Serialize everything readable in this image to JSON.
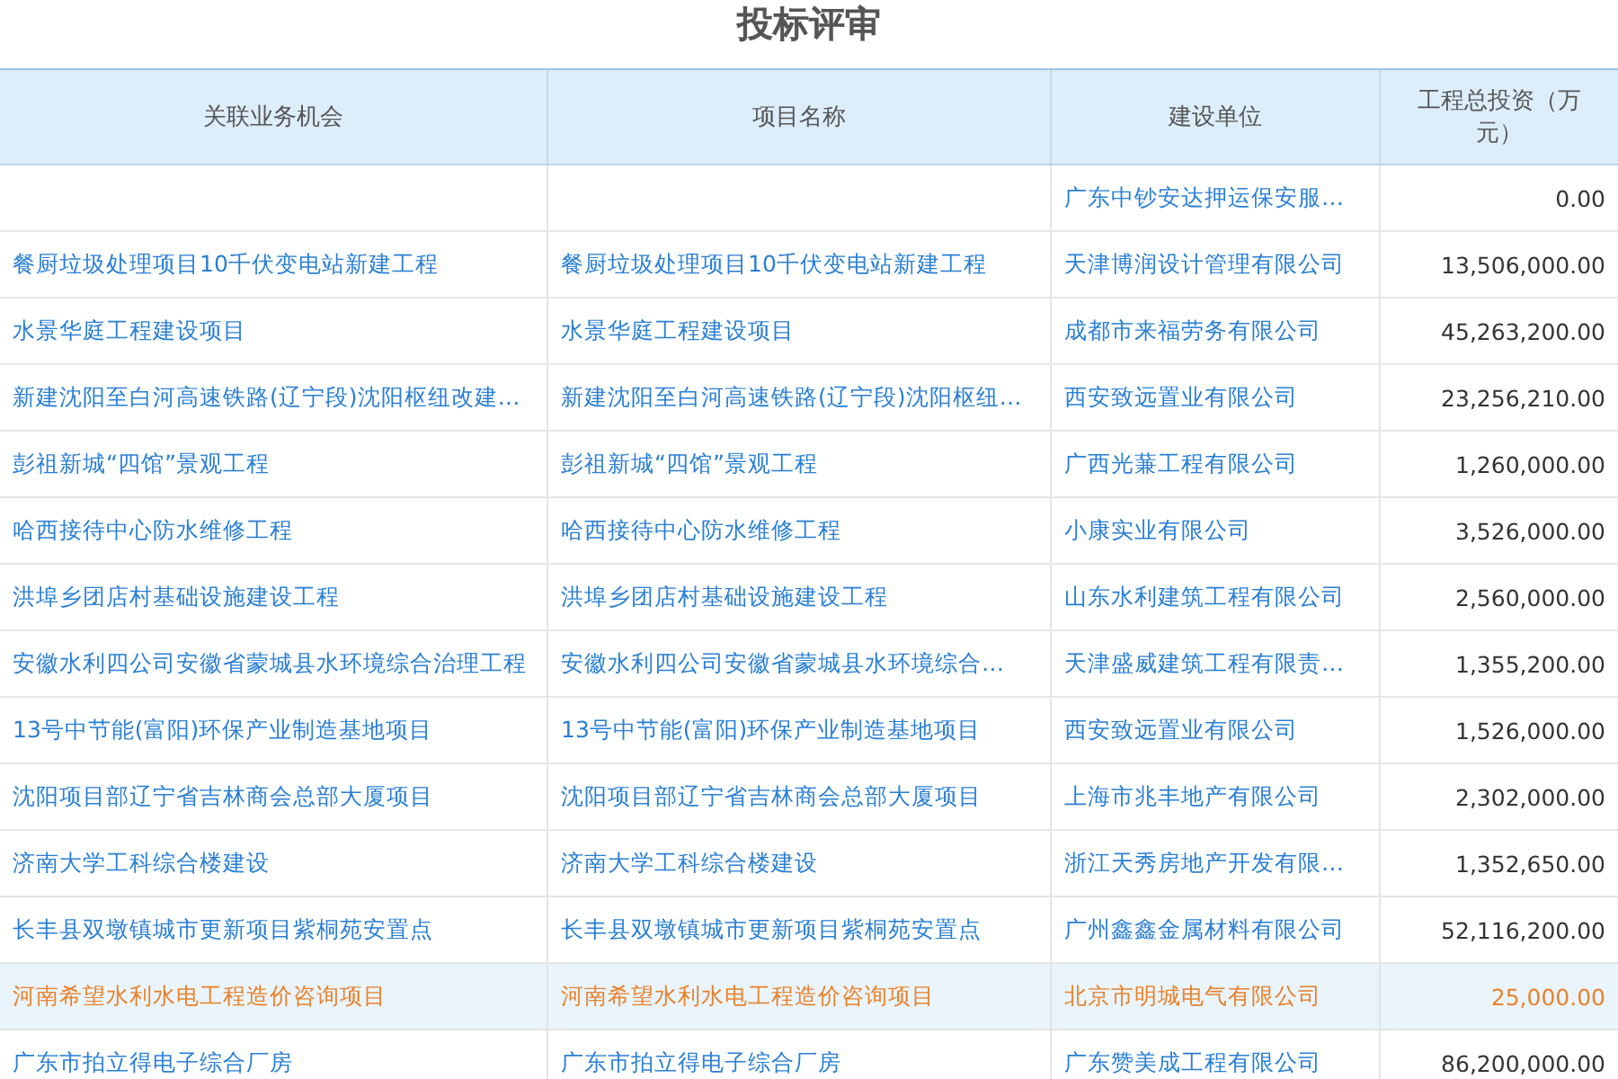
{
  "title": "投标评审",
  "table": {
    "columns": [
      "关联业务机会",
      "项目名称",
      "建设单位",
      "工程总投资（万元）"
    ],
    "rows": [
      {
        "cells": [
          "",
          "",
          "广东中钞安达押运保安服…",
          "0.00"
        ],
        "selected": false
      },
      {
        "cells": [
          "餐厨垃圾处理项目10千伏变电站新建工程",
          "餐厨垃圾处理项目10千伏变电站新建工程",
          "天津博润设计管理有限公司",
          "13,506,000.00"
        ],
        "selected": false
      },
      {
        "cells": [
          "水景华庭工程建设项目",
          "水景华庭工程建设项目",
          "成都市来福劳务有限公司",
          "45,263,200.00"
        ],
        "selected": false
      },
      {
        "cells": [
          "新建沈阳至白河高速铁路(辽宁段)沈阳枢纽改建…",
          "新建沈阳至白河高速铁路(辽宁段)沈阳枢纽…",
          "西安致远置业有限公司",
          "23,256,210.00"
        ],
        "selected": false
      },
      {
        "cells": [
          "彭祖新城“四馆”景观工程",
          "彭祖新城“四馆”景观工程",
          "广西光蒹工程有限公司",
          "1,260,000.00"
        ],
        "selected": false
      },
      {
        "cells": [
          "哈西接待中心防水维修工程",
          "哈西接待中心防水维修工程",
          "小康实业有限公司",
          "3,526,000.00"
        ],
        "selected": false
      },
      {
        "cells": [
          "洪埠乡团店村基础设施建设工程",
          "洪埠乡团店村基础设施建设工程",
          "山东水利建筑工程有限公司",
          "2,560,000.00"
        ],
        "selected": false
      },
      {
        "cells": [
          "安徽水利四公司安徽省蒙城县水环境综合治理工程",
          "安徽水利四公司安徽省蒙城县水环境综合…",
          "天津盛威建筑工程有限责…",
          "1,355,200.00"
        ],
        "selected": false
      },
      {
        "cells": [
          "13号中节能(富阳)环保产业制造基地项目",
          "13号中节能(富阳)环保产业制造基地项目",
          "西安致远置业有限公司",
          "1,526,000.00"
        ],
        "selected": false
      },
      {
        "cells": [
          "沈阳项目部辽宁省吉林商会总部大厦项目",
          "沈阳项目部辽宁省吉林商会总部大厦项目",
          "上海市兆丰地产有限公司",
          "2,302,000.00"
        ],
        "selected": false
      },
      {
        "cells": [
          "济南大学工科综合楼建设",
          "济南大学工科综合楼建设",
          "浙江天秀房地产开发有限…",
          "1,352,650.00"
        ],
        "selected": false
      },
      {
        "cells": [
          "长丰县双墩镇城市更新项目紫桐苑安置点",
          "长丰县双墩镇城市更新项目紫桐苑安置点",
          "广州鑫鑫金属材料有限公司",
          "52,116,200.00"
        ],
        "selected": false
      },
      {
        "cells": [
          "河南希望水利水电工程造价咨询项目",
          "河南希望水利水电工程造价咨询项目",
          "北京市明城电气有限公司",
          "25,000.00"
        ],
        "selected": true
      },
      {
        "cells": [
          "广东市拍立得电子综合厂房",
          "广东市拍立得电子综合厂房",
          "广东赞美成工程有限公司",
          "86,200,000.00"
        ],
        "selected": false
      }
    ]
  }
}
